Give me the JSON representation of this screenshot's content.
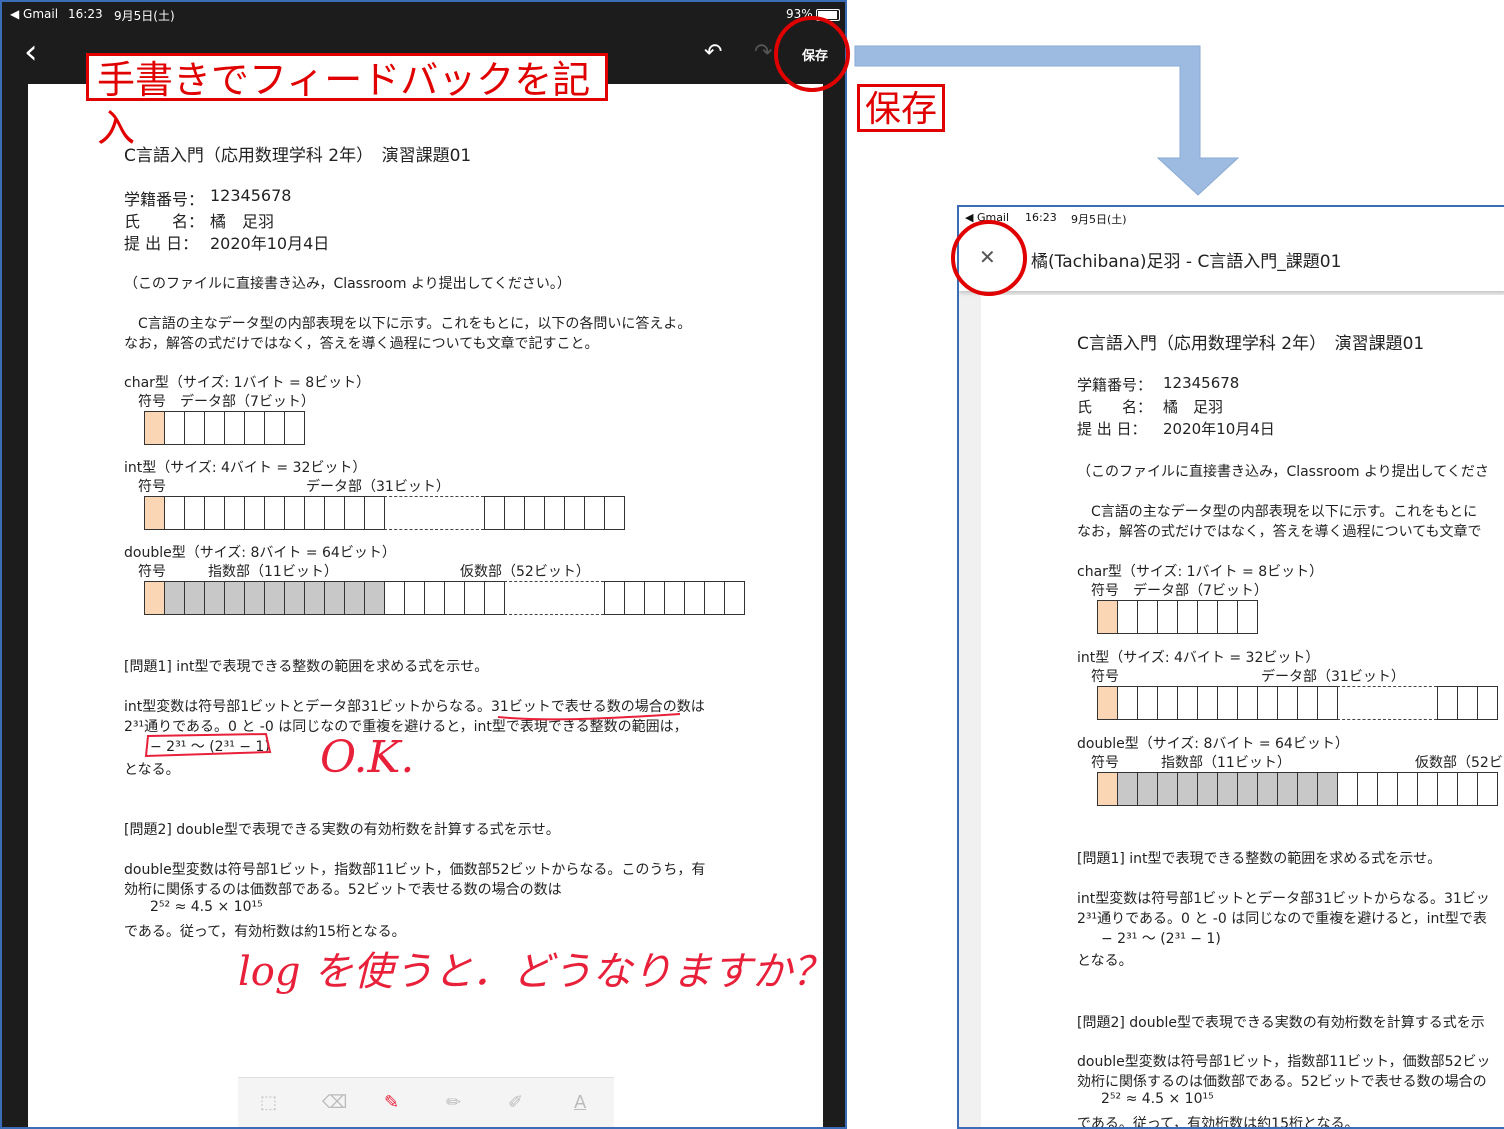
{
  "left": {
    "status": {
      "app": "◀ Gmail",
      "time": "16:23",
      "date": "9月5日(土)",
      "battery": "93%"
    },
    "toolbar": {
      "back": "‹",
      "undo": "↶",
      "redo": "↷",
      "save": "保存"
    },
    "doc": {
      "title": "C言語入門（応用数理学科 2年）　演習課題01",
      "student_id_label": "学籍番号：",
      "student_id": "12345678",
      "name_label": "氏　　名：",
      "name": "橘　足羽",
      "date_label": "提 出 日：",
      "date": "2020年10月4日",
      "note": "（このファイルに直接書き込み，Classroom より提出してください。）",
      "intro1": "C言語の主なデータ型の内部表現を以下に示す。これをもとに，以下の各問いに答えよ。",
      "intro2": "なお，解答の式だけではなく，答えを導く過程についても文章で記すこと。",
      "char_label": "char型（サイズ: 1バイト = 8ビット）",
      "char_sub": "符号　データ部（7ビット）",
      "int_label": "int型（サイズ: 4バイト = 32ビット）",
      "int_sign": "符号",
      "int_data": "データ部（31ビット）",
      "double_label": "double型（サイズ: 8バイト = 64ビット）",
      "double_sign": "符号",
      "double_exp": "指数部（11ビット）",
      "double_frac": "仮数部（52ビット）",
      "q1": "[問題1] int型で表現できる整数の範囲を求める式を示せ。",
      "a1_1": "int型変数は符号部1ビットとデータ部31ビットからなる。31ビットで表せる数の場合の数は",
      "a1_2": "2³¹通りである。0 と -0 は同じなので重複を避けると，int型で表現できる整数の範囲は，",
      "a1_3": "− 2³¹ ～ (2³¹ − 1)",
      "a1_4": "となる。",
      "q2": "[問題2] double型で表現できる実数の有効桁数を計算する式を示せ。",
      "a2_1": "double型変数は符号部1ビット，指数部11ビット，価数部52ビットからなる。このうち，有",
      "a2_2": "効桁に関係するのは価数部である。52ビットで表せる数の場合の数は",
      "a2_3": "2⁵² ≈ 4.5 × 10¹⁵",
      "a2_4": "である。従って，有効桁数は約15桁となる。"
    },
    "handwriting": {
      "ok": "O.K.",
      "question": "log を使うと．どうなりますか？"
    },
    "callout": "手書きでフィードバックを記入",
    "tools": [
      "select-icon",
      "eraser-icon",
      "pen-icon",
      "pencil-icon",
      "marker-icon",
      "text-icon"
    ],
    "tool_glyphs": [
      "⬚",
      "⌫",
      "✎",
      "✏",
      "✐",
      "A"
    ]
  },
  "save_callout": "保存",
  "right": {
    "status": {
      "app": "◀ Gmail",
      "time": "16:23",
      "date": "9月5日(土)"
    },
    "header": {
      "close": "✕",
      "title": "橘(Tachibana)足羽 - C言語入門_課題01"
    },
    "doc": {
      "title": "C言語入門（応用数理学科 2年）　演習課題01",
      "student_id_label": "学籍番号：",
      "student_id": "12345678",
      "name_label": "氏　　名：",
      "name": "橘　足羽",
      "date_label": "提 出 日：",
      "date": "2020年10月4日",
      "note": "（このファイルに直接書き込み，Classroom より提出してくださ",
      "intro1": "C言語の主なデータ型の内部表現を以下に示す。これをもとに",
      "intro2": "なお，解答の式だけではなく，答えを導く過程についても文章で",
      "char_label": "char型（サイズ: 1バイト = 8ビット）",
      "char_sub": "符号　データ部（7ビット）",
      "int_label": "int型（サイズ: 4バイト = 32ビット）",
      "int_sign": "符号",
      "int_data": "データ部（31ビット）",
      "double_label": "double型（サイズ: 8バイト = 64ビット）",
      "double_sign": "符号",
      "double_exp": "指数部（11ビット）",
      "double_frac": "仮数部（52ビ",
      "q1": "[問題1] int型で表現できる整数の範囲を求める式を示せ。",
      "a1_1": "int型変数は符号部1ビットとデータ部31ビットからなる。31ビッ",
      "a1_2": "2³¹通りである。0 と -0 は同じなので重複を避けると，int型で表",
      "a1_3": "− 2³¹ ～ (2³¹ − 1)",
      "a1_4": "となる。",
      "q2": "[問題2] double型で表現できる実数の有効桁数を計算する式を示",
      "a2_1": "double型変数は符号部1ビット，指数部11ビット，価数部52ビッ",
      "a2_2": "効桁に関係するのは価数部である。52ビットで表せる数の場合の",
      "a2_3": "2⁵² ≈ 4.5 × 10¹⁵",
      "a2_4": "である。従って，有効桁数は約15桁となる。"
    }
  }
}
